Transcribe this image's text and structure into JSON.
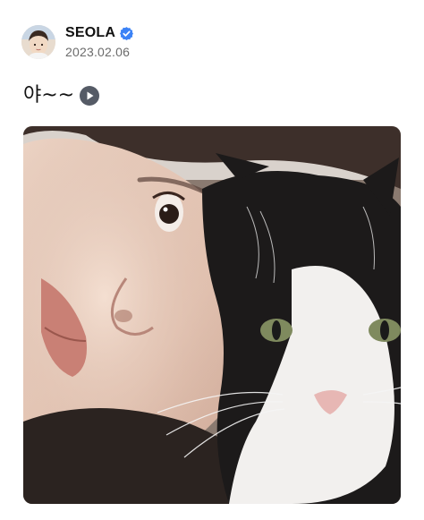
{
  "post": {
    "author": {
      "name": "SEOLA",
      "verified": true,
      "avatar_icon": "profile-avatar"
    },
    "date": "2023.02.06",
    "caption": "야~~",
    "caption_icon": "play-icon",
    "media": {
      "type": "photo",
      "icon": "selfie-with-cat-image"
    }
  },
  "colors": {
    "verified_badge": "#3b82f6",
    "date_text": "#6b6b6b",
    "play_button": "#555b66"
  }
}
